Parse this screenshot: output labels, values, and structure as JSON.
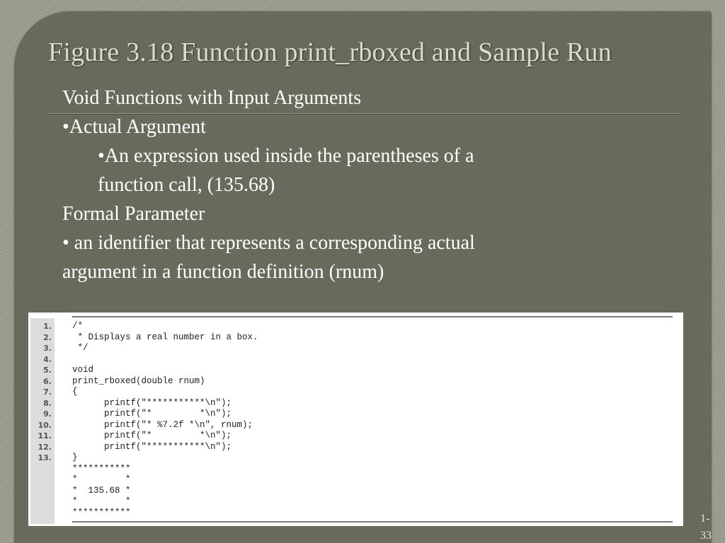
{
  "slide": {
    "title": "Figure 3.18  Function print_rboxed and Sample Run",
    "body_lines": [
      "Void Functions with Input Arguments",
      "•Actual Argument",
      "•An expression used inside the parentheses of a",
      "function call, (135.68)",
      "Formal Parameter",
      "• an identifier that represents a corresponding actual",
      "argument in a function definition (rnum)"
    ],
    "page_number": [
      "1-",
      "33"
    ]
  },
  "code_figure": {
    "line_numbers": [
      "1.",
      "2.",
      "3.",
      "4.",
      "5.",
      "6.",
      "7.",
      "8.",
      "9.",
      "10.",
      "11.",
      "12.",
      "13."
    ],
    "code_lines": [
      "/*",
      " * Displays a real number in a box.",
      " */",
      "",
      "void",
      "print_rboxed(double rnum)",
      "{",
      "      printf(\"***********\\n\");",
      "      printf(\"*         *\\n\");",
      "      printf(\"* %7.2f *\\n\", rnum);",
      "      printf(\"*         *\\n\");",
      "      printf(\"***********\\n\");",
      "}"
    ],
    "sample_run_lines": [
      "***********",
      "*         *",
      "*  135.68 *",
      "*         *",
      "***********"
    ]
  }
}
